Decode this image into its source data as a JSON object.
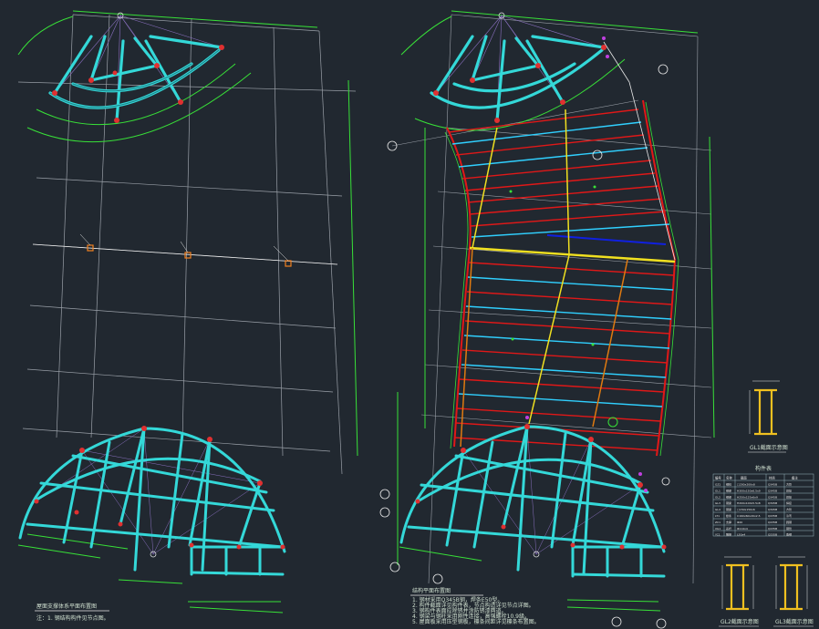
{
  "drawing": {
    "background": "#212830",
    "colors": {
      "frame": "#9aa0a8",
      "dimension": "#38e038",
      "steel": "#34d8d8",
      "steel_dark": "#2aa8b0",
      "beam_red": "#e01818",
      "beam_cyan": "#30d0ff",
      "beam_yellow": "#f0e020",
      "beam_orange": "#e07a10",
      "beam_blue": "#1020e0",
      "node": "#e03030",
      "node_orange": "#f08020",
      "magenta": "#c040e0",
      "white_text": "#e8e8e8"
    }
  },
  "plan_left": {
    "title": "屋面支撑体系平面布置图",
    "note": "注：1. 钢结构构件见节点图。"
  },
  "plan_right": {
    "title": "结构平面布置图",
    "notes": [
      "1. 钢材采用Q345B钢，焊条E50型。",
      "2. 构件截面详见构件表，节点构造详见节点详图。",
      "3. 钢构件表面应除锈并涂防锈漆两道。",
      "4. 钢梁与钢柱采用刚性连接，高强螺栓10.9级。",
      "5. 屋面板采用压型钢板，檩条间距详见檩条布置图。"
    ]
  },
  "detail_top": {
    "caption": "GL1截面示意图"
  },
  "detail_bottom_left": {
    "caption": "GL2截面示意图"
  },
  "detail_bottom_right": {
    "caption": "GL3截面示意图"
  },
  "member_table": {
    "title": "构件表",
    "headers": [
      "编号",
      "名称",
      "截面",
      "材质",
      "备注"
    ],
    "rows": [
      [
        "GZ1",
        "钢柱",
        "□200x200x8",
        "Q345B",
        "方管"
      ],
      [
        "GL1",
        "钢梁",
        "H300x150x6.5x9",
        "Q345B",
        "焊接"
      ],
      [
        "GL2",
        "钢梁",
        "H250x125x6x9",
        "Q345B",
        "焊接"
      ],
      [
        "GL3",
        "钢梁",
        "H200x100x5.5x8",
        "Q345B",
        "焊接"
      ],
      [
        "GL4",
        "钢梁",
        "□150x150x6",
        "Q345B",
        "方管"
      ],
      [
        "LT1",
        "檩条",
        "C160x60x20x2.5",
        "Q235B",
        "冷弯"
      ],
      [
        "ZC1",
        "支撑",
        "Φ20",
        "Q235B",
        "圆钢"
      ],
      [
        "XG1",
        "系杆",
        "Φ114x4",
        "Q235B",
        "钢管"
      ],
      [
        "YC1",
        "隅撑",
        "L50x4",
        "Q235B",
        "角钢"
      ]
    ]
  }
}
